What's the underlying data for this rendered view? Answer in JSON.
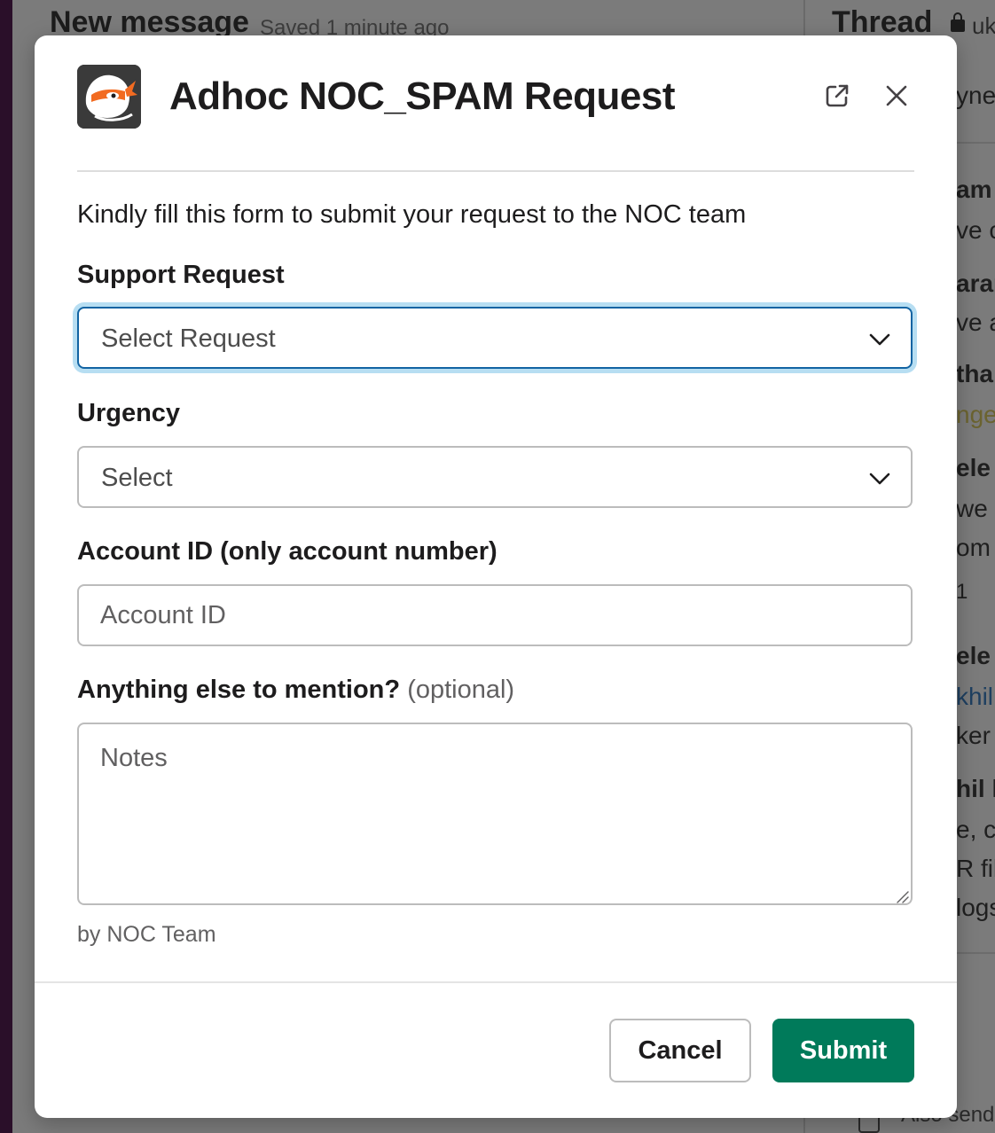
{
  "background": {
    "composer_title": "New message",
    "saved_status": "Saved 1 minute ago",
    "thread_title": "Thread",
    "thread_subtitle": "uk",
    "fragments": [
      "ynes",
      "am",
      "ve c",
      "aram",
      "ve a",
      "tha",
      "ngel",
      "ele",
      "we",
      "om",
      "1",
      "ele",
      "khil",
      "ker",
      "hil h",
      "e, ca",
      "R file",
      "logs"
    ],
    "bottom_text": "Also send"
  },
  "modal": {
    "title": "Adhoc NOC_SPAM Request",
    "intro": "Kindly fill this form to submit your request to the NOC team",
    "fields": {
      "support_request": {
        "label": "Support Request",
        "placeholder": "Select Request"
      },
      "urgency": {
        "label": "Urgency",
        "placeholder": "Select"
      },
      "account_id": {
        "label": "Account ID (only account number)",
        "placeholder": "Account ID",
        "value": ""
      },
      "notes": {
        "label": "Anything else to mention?",
        "optional_label": "(optional)",
        "placeholder": "Notes",
        "value": ""
      }
    },
    "attribution": "by NOC Team",
    "buttons": {
      "cancel": "Cancel",
      "submit": "Submit"
    }
  },
  "colors": {
    "primary": "#007a5a",
    "focus_border": "#1264a3",
    "focus_ring": "#b7def2",
    "logo_accent": "#f26b21"
  },
  "icons": {
    "app_logo": "ninja-logo",
    "open_in_new": "external-link-icon",
    "close": "close-icon",
    "dropdown": "chevron-down-icon"
  }
}
